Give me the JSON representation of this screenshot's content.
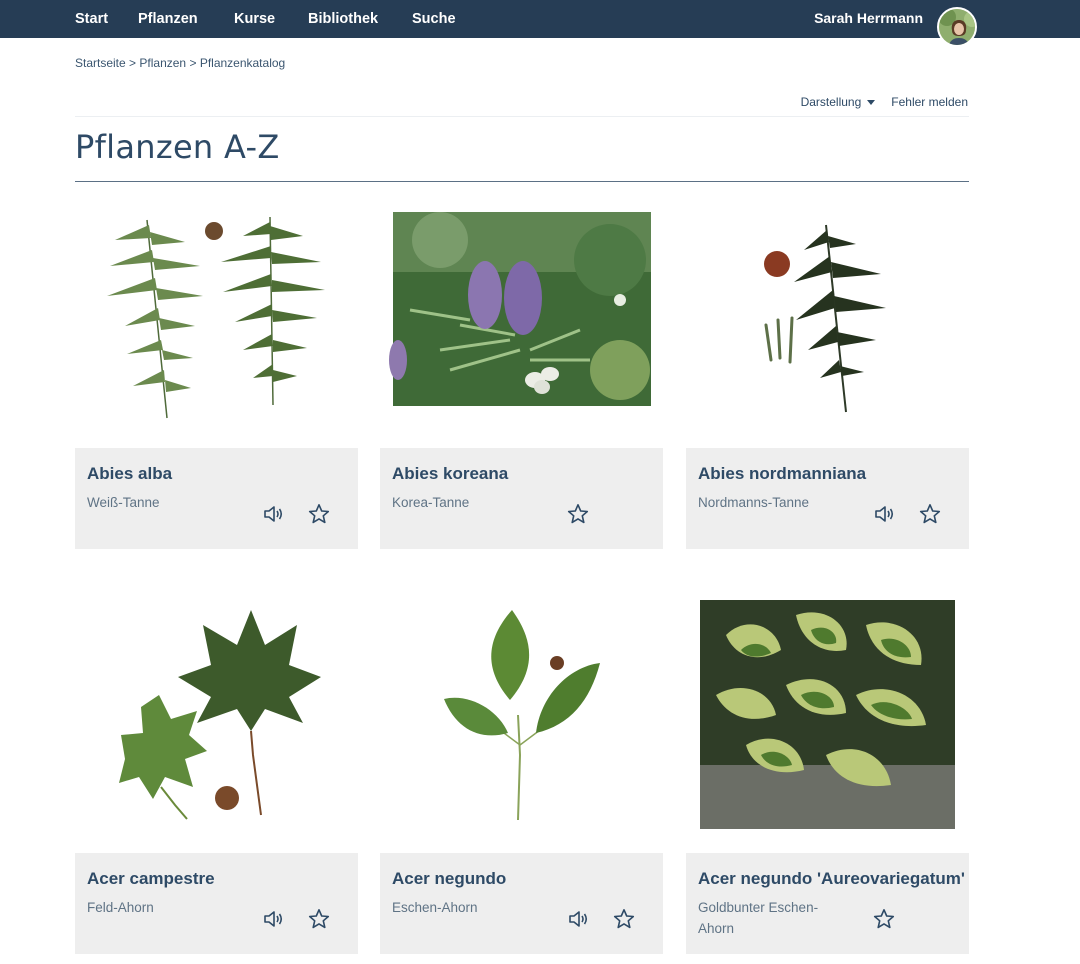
{
  "nav": {
    "items": [
      {
        "label": "Start"
      },
      {
        "label": "Pflanzen"
      },
      {
        "label": "Kurse"
      },
      {
        "label": "Bibliothek"
      },
      {
        "label": "Suche"
      }
    ],
    "user_name": "Sarah Herrmann"
  },
  "breadcrumb": {
    "items": [
      "Startseite",
      "Pflanzen",
      "Pflanzenkatalog"
    ],
    "separator": ">"
  },
  "toolbar": {
    "view_label": "Darstellung",
    "report_label": "Fehler melden"
  },
  "page": {
    "title": "Pflanzen A-Z"
  },
  "cards": [
    {
      "latin": "Abies alba",
      "common": "Weiß-Tanne",
      "audio": true,
      "favorite": false
    },
    {
      "latin": "Abies koreana",
      "common": "Korea-Tanne",
      "audio": false,
      "favorite": false
    },
    {
      "latin": "Abies nordmanniana",
      "common": "Nordmanns-Tanne",
      "audio": true,
      "favorite": false
    },
    {
      "latin": "Acer campestre",
      "common": "Feld-Ahorn",
      "audio": true,
      "favorite": false
    },
    {
      "latin": "Acer negundo",
      "common": "Eschen-Ahorn",
      "audio": true,
      "favorite": false
    },
    {
      "latin": "Acer negundo 'Aureovariegatum'",
      "common": "Goldbunter Eschen-Ahorn",
      "audio": false,
      "favorite": false
    }
  ],
  "colors": {
    "nav_bg": "#263d55",
    "text": "#2e4a66",
    "card_panel": "#eeeeee"
  }
}
